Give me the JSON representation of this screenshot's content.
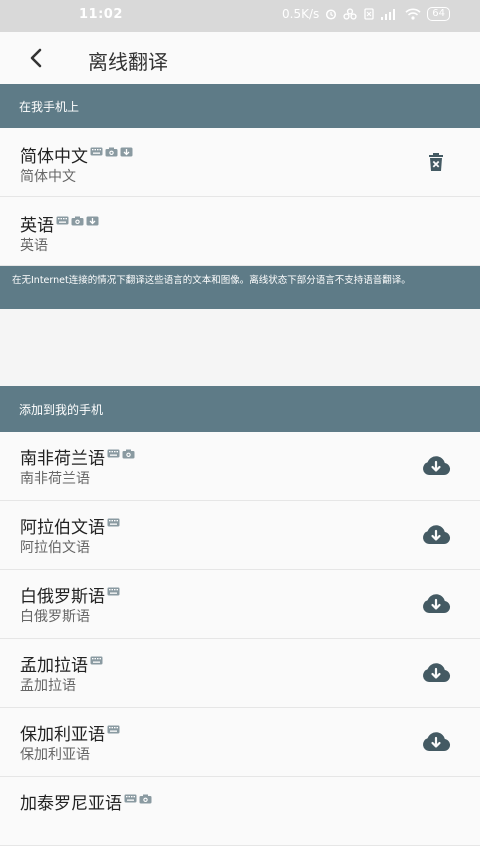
{
  "status_bar": {
    "time": "11:02",
    "net_speed": "0.5K/s",
    "battery": "64"
  },
  "app_bar": {
    "title": "离线翻译",
    "back_icon": "arrow-back-icon"
  },
  "on_phone": {
    "header": "在我手机上",
    "items": [
      {
        "name": "简体中文",
        "subtitle": "简体中文",
        "caps": [
          "keyboard",
          "camera",
          "mic-download"
        ],
        "action": "delete"
      },
      {
        "name": "英语",
        "subtitle": "英语",
        "caps": [
          "keyboard",
          "camera",
          "mic-download"
        ],
        "action": ""
      }
    ],
    "info": "在无Internet连接的情况下翻译这些语言的文本和图像。离线状态下部分语言不支持语音翻译。"
  },
  "add_to_phone": {
    "header": "添加到我的手机",
    "items": [
      {
        "name": "南非荷兰语",
        "subtitle": "南非荷兰语",
        "caps": [
          "keyboard",
          "camera"
        ],
        "action": "download"
      },
      {
        "name": "阿拉伯文语",
        "subtitle": "阿拉伯文语",
        "caps": [
          "keyboard"
        ],
        "action": "download"
      },
      {
        "name": "白俄罗斯语",
        "subtitle": "白俄罗斯语",
        "caps": [
          "keyboard"
        ],
        "action": "download"
      },
      {
        "name": "孟加拉语",
        "subtitle": "孟加拉语",
        "caps": [
          "keyboard"
        ],
        "action": "download"
      },
      {
        "name": "保加利亚语",
        "subtitle": "保加利亚语",
        "caps": [
          "keyboard"
        ],
        "action": "download"
      },
      {
        "name": "加泰罗尼亚语",
        "subtitle": "",
        "caps": [
          "keyboard",
          "camera"
        ],
        "action": ""
      }
    ]
  },
  "colors": {
    "section": "#5e7b87",
    "icon": "#445a63"
  }
}
